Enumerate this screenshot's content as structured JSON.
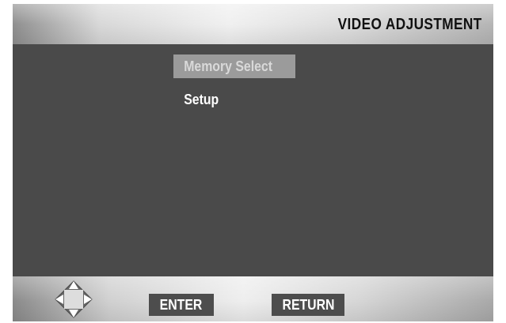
{
  "header": {
    "title": "VIDEO ADJUSTMENT"
  },
  "menu": {
    "items": [
      {
        "label": "Memory Select",
        "selected": true
      },
      {
        "label": "Setup",
        "selected": false
      }
    ]
  },
  "footer": {
    "navigation_icon": "dpad-icon",
    "enter_label": "ENTER",
    "return_label": "RETURN"
  },
  "colors": {
    "panel_background": "#4a4a4a",
    "selected_highlight": "#9b9b9b",
    "button_background": "#4d4d4d",
    "text_white": "#ffffff"
  }
}
